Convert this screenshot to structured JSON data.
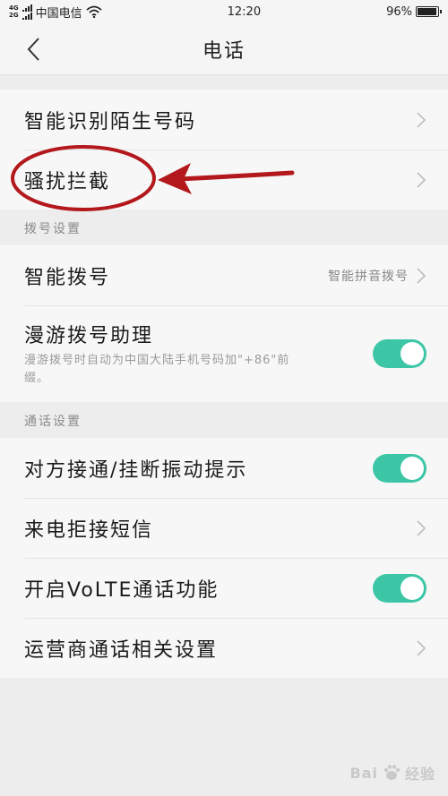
{
  "status_bar": {
    "network_tags": [
      "4G",
      "2G"
    ],
    "carrier": "中国电信",
    "time": "12:20",
    "battery_percent": "96%",
    "battery_level": 0.96
  },
  "nav": {
    "title": "电话",
    "back_icon": "chevron-left-icon"
  },
  "group1": {
    "items": [
      {
        "label": "智能识别陌生号码"
      },
      {
        "label": "骚扰拦截"
      }
    ]
  },
  "section_dial": {
    "header": "拨号设置",
    "smart_dial": {
      "label": "智能拨号",
      "value": "智能拼音拨号"
    },
    "roaming": {
      "label": "漫游拨号助理",
      "description": "漫游拨号时自动为中国大陆手机号码加\"+86\"前缀。",
      "enabled": true
    }
  },
  "section_call": {
    "header": "通话设置",
    "vibrate": {
      "label": "对方接通/挂断振动提示",
      "enabled": true
    },
    "sms_reject": {
      "label": "来电拒接短信"
    },
    "volte": {
      "label": "开启VoLTE通话功能",
      "enabled": true
    },
    "carrier_settings": {
      "label": "运营商通话相关设置"
    }
  },
  "colors": {
    "accent": "#3dc6a6",
    "annotation": "#b3181c"
  },
  "watermark": {
    "text": "经验",
    "brand": "Bai"
  }
}
